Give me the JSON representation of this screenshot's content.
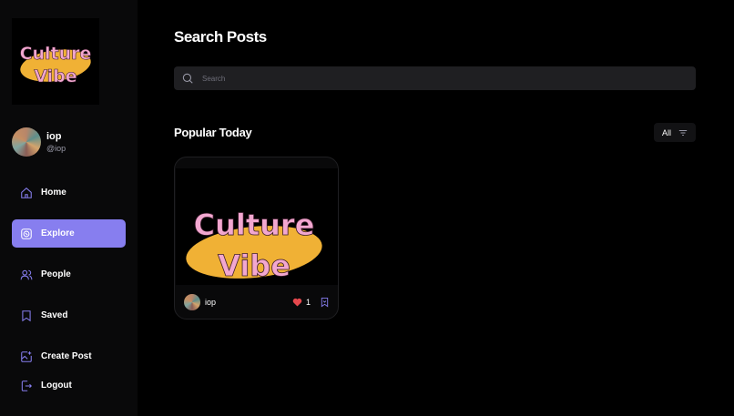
{
  "brand": {
    "logo_line1": "Culture",
    "logo_line2": "Vibe"
  },
  "profile": {
    "name": "iop",
    "handle": "@iop"
  },
  "sidebar": {
    "items": [
      {
        "label": "Home",
        "icon": "home-icon"
      },
      {
        "label": "Explore",
        "icon": "explore-icon",
        "active": true
      },
      {
        "label": "People",
        "icon": "people-icon"
      },
      {
        "label": "Saved",
        "icon": "bookmark-icon"
      },
      {
        "label": "Create Post",
        "icon": "create-post-icon"
      },
      {
        "label": "Logout",
        "icon": "logout-icon"
      }
    ]
  },
  "search": {
    "title": "Search Posts",
    "placeholder": "Search"
  },
  "popular": {
    "title": "Popular Today",
    "filter_label": "All"
  },
  "posts": [
    {
      "author": "iop",
      "likes": "1",
      "image_line1": "Culture",
      "image_line2": "Vibe"
    }
  ],
  "colors": {
    "accent": "#877eef",
    "logo_pink": "#f2a7d0",
    "logo_yellow": "#f0b135",
    "like_red": "#e5484d"
  }
}
